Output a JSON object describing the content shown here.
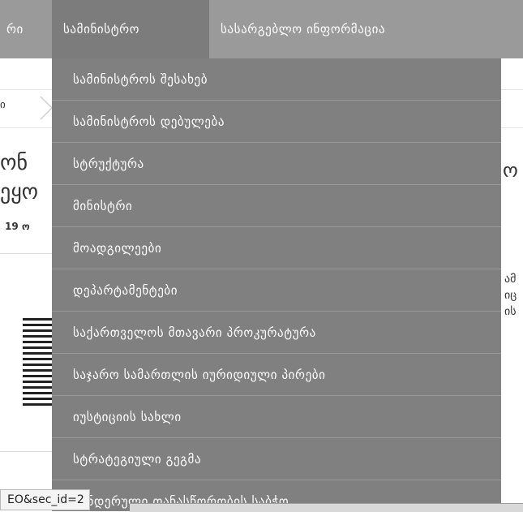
{
  "nav": {
    "partial_label": "რი",
    "active_label": "სამინისტრო",
    "legal_label": "სასარგებლო ინფორმაცია"
  },
  "background": {
    "crumb_fragment": "ი",
    "title_line1_fragment": "ონ",
    "title_line2_fragment": "ეყო",
    "date_fragment": "19 ო",
    "right_fragment_1": "ამ",
    "right_fragment_2": "იც",
    "right_fragment_3": "ის",
    "right_heading_fragment": "ო"
  },
  "dropdown": {
    "items": [
      "სამინისტროს შესახებ",
      "სამინისტროს დებულება",
      "სტრუქტურა",
      "მინისტრი",
      "მოადგილეები",
      "დეპარტამენტები",
      "საქართველოს მთავარი პროკურატურა",
      "საჯარო სამართლის იურიდიული პირები",
      "იუსტიციის სახლი",
      "სტრატეგიული გეგმა",
      "გენდერული თანასწორობის საბჭო"
    ]
  },
  "status_bar": {
    "url_text": "EO&sec_id=2"
  }
}
